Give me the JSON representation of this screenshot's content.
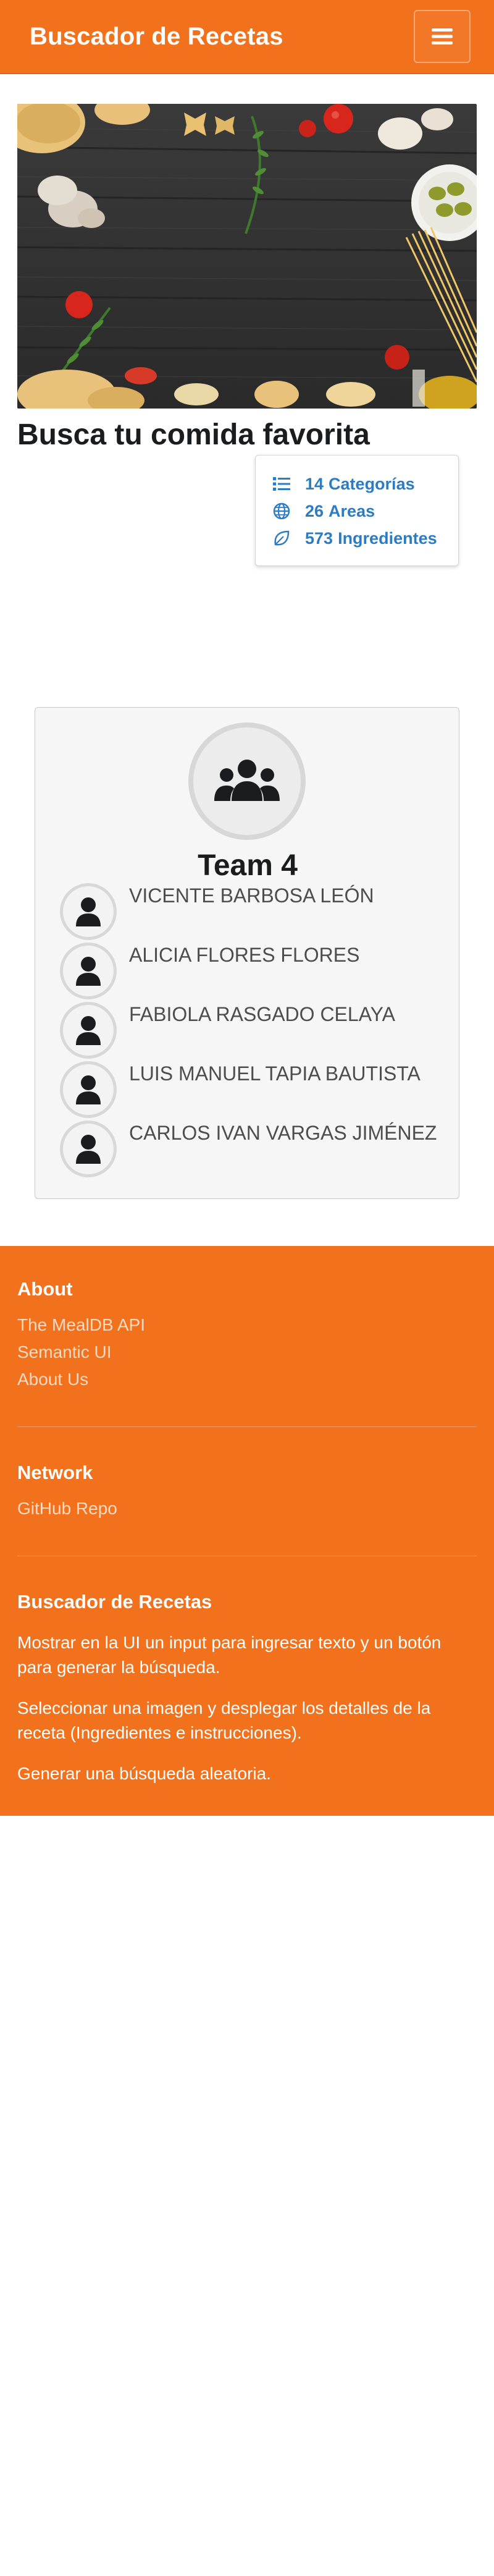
{
  "header": {
    "brand": "Buscador de Recetas",
    "menu_icon": "hamburger-icon"
  },
  "hero": {
    "image_subject": "pasta-ingredients-on-wood"
  },
  "main": {
    "title": "Busca tu comida favorita",
    "stats": [
      {
        "icon": "list-icon",
        "count": "14",
        "label": "Categorías"
      },
      {
        "icon": "globe-icon",
        "count": "26",
        "label": "Areas"
      },
      {
        "icon": "leaf-icon",
        "count": "573",
        "label": "Ingredientes"
      }
    ]
  },
  "team": {
    "icon": "users-icon",
    "title": "Team 4",
    "members": [
      "VICENTE BARBOSA LEÓN",
      "ALICIA FLORES FLORES",
      "FABIOLA RASGADO CELAYA",
      "LUIS MANUEL TAPIA BAUTISTA",
      "CARLOS IVAN VARGAS JIMÉNEZ"
    ]
  },
  "footer": {
    "about": {
      "heading": "About",
      "links": [
        "The MealDB API",
        "Semantic UI",
        "About Us"
      ]
    },
    "network": {
      "heading": "Network",
      "links": [
        "GitHub Repo"
      ]
    },
    "app": {
      "heading": "Buscador de Recetas",
      "paragraphs": [
        "Mostrar en la UI un input para ingresar texto y un botón para generar la búsqueda.",
        "Seleccionar una imagen y desplegar los detalles de la receta (Ingredientes e instrucciones).",
        "Generar una búsqueda aleatoria."
      ]
    }
  },
  "colors": {
    "primary": "#f2711c",
    "link_blue": "#2c7cc4",
    "footer_link": "#ffd9c2"
  }
}
